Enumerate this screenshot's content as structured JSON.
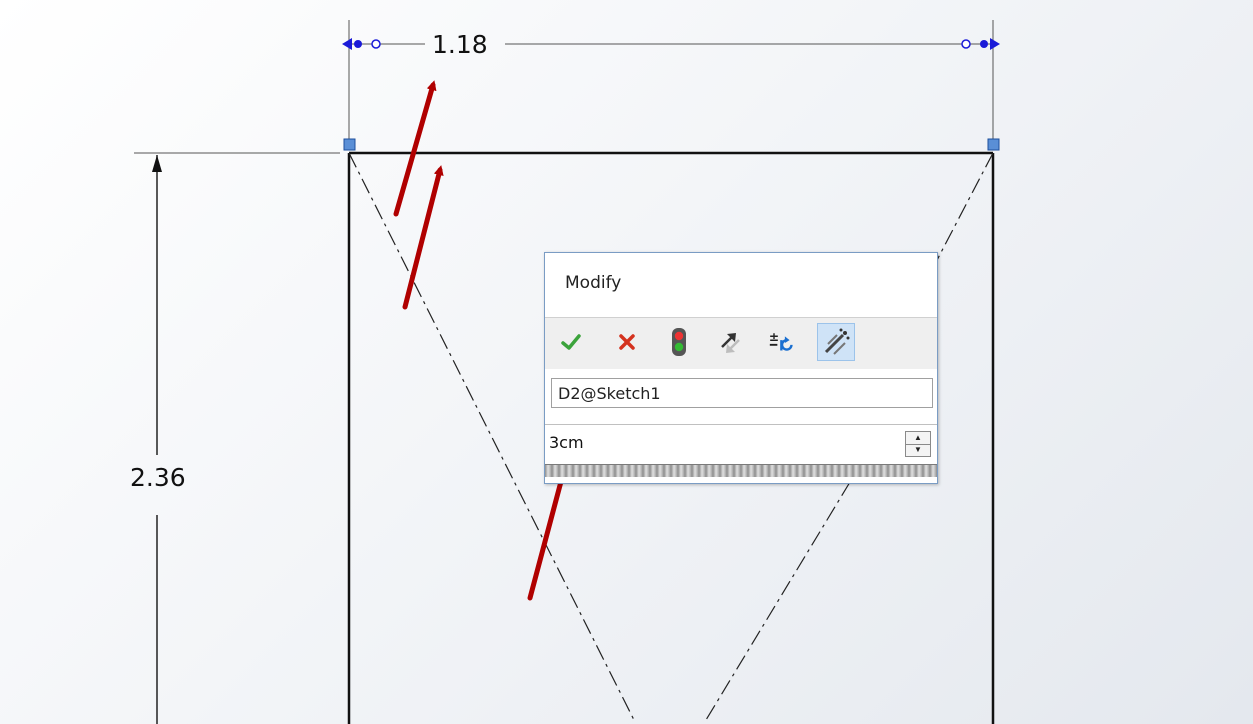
{
  "dimensions": {
    "horizontal": "1.18",
    "vertical": "2.36"
  },
  "dialog": {
    "title": "Modify",
    "toolbar": {
      "ok_icon": "checkmark-icon",
      "cancel_icon": "x-icon",
      "rebuild_icon": "traffic-light-icon",
      "reverse_icon": "reverse-direction-icon",
      "reset_icon": "reset-spin-increment-icon",
      "mark_icon": "mark-for-drawing-icon"
    },
    "dimension_name": "D2@Sketch1",
    "value": "3cm"
  },
  "colors": {
    "annotation_arrow": "#b00000",
    "ok_green": "#3ba33b",
    "cancel_red": "#d4321e",
    "handle_blue": "#1a1ad8",
    "point_blue": "#5a8fd6"
  }
}
